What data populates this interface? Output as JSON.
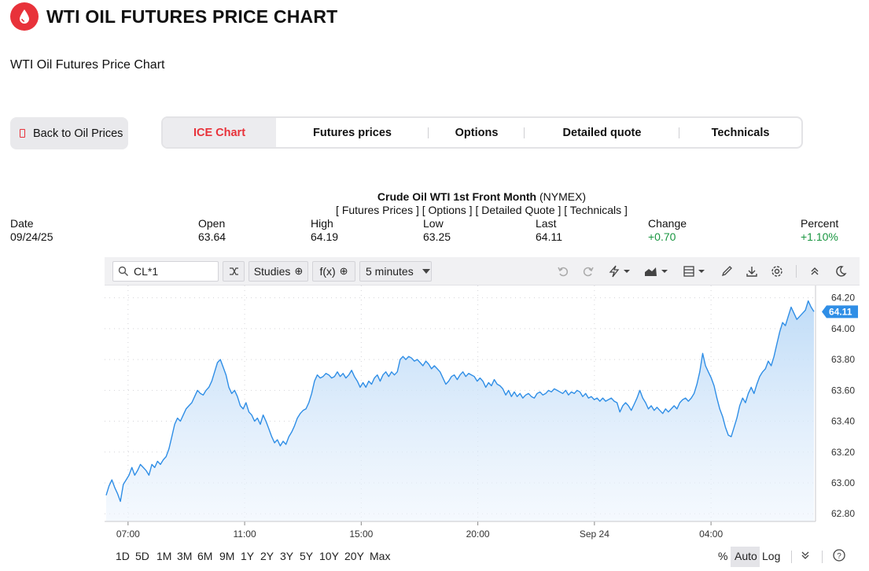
{
  "page": {
    "title": "WTI OIL FUTURES PRICE CHART",
    "subtitle": "WTI Oil Futures Price Chart",
    "back_label": "Back to Oil Prices",
    "brand_color": "#e8323a",
    "logo_icon": "oil-drop-icon"
  },
  "tabs": [
    {
      "label": "ICE Chart",
      "active": true
    },
    {
      "label": "Futures prices",
      "active": false
    },
    {
      "label": "Options",
      "active": false
    },
    {
      "label": "Detailed quote",
      "active": false
    },
    {
      "label": "Technicals",
      "active": false
    }
  ],
  "instrument": {
    "name": "Crude Oil WTI 1st Front Month",
    "exchange": "(NYMEX)",
    "links": "[ Futures Prices ] [ Options ] [ Detailed Quote ] [ Technicals ]"
  },
  "quote": {
    "date_label": "Date",
    "date": "09/24/25",
    "open_label": "Open",
    "open": "63.64",
    "high_label": "High",
    "high": "64.19",
    "low_label": "Low",
    "low": "63.25",
    "last_label": "Last",
    "last": "64.11",
    "change_label": "Change",
    "change": "+0.70",
    "percent_label": "Percent",
    "percent": "+1.10%",
    "positive_color": "#1a9641"
  },
  "toolbar": {
    "symbol": "CL*1",
    "studies_label": "Studies",
    "fx_label": "f(x)",
    "interval": "5 minutes",
    "icons": [
      "search-icon",
      "compare-icon",
      "undo-icon",
      "redo-icon",
      "lightning-icon",
      "area-chart-icon",
      "layout-icon",
      "pencil-icon",
      "download-icon",
      "settings-icon",
      "collapse-icon",
      "dark-mode-icon"
    ]
  },
  "chart_data": {
    "type": "area",
    "y_ticks": [
      "64.20",
      "64.00",
      "63.80",
      "63.60",
      "63.40",
      "63.20",
      "63.00",
      "62.80"
    ],
    "x_ticks": [
      "07:00",
      "11:00",
      "15:00",
      "20:00",
      "Sep 24",
      "04:00"
    ],
    "last_price_label": "64.11",
    "ylim": [
      62.75,
      64.28
    ],
    "grid": true,
    "line_color": "#2f8ee6",
    "x": [
      0,
      1,
      2,
      3,
      4,
      5,
      6,
      7,
      8,
      9,
      10,
      11,
      12,
      13,
      14,
      15,
      16,
      17,
      18,
      19,
      20,
      21,
      22,
      23,
      24,
      25,
      26,
      27,
      28,
      29,
      30,
      31,
      32,
      33,
      34,
      35,
      36,
      37,
      38,
      39,
      40,
      41,
      42,
      43,
      44,
      45,
      46,
      47,
      48,
      49,
      50,
      51,
      52,
      53,
      54,
      55,
      56,
      57,
      58,
      59,
      60,
      61,
      62,
      63,
      64,
      65,
      66,
      67,
      68,
      69,
      70,
      71,
      72,
      73,
      74,
      75,
      76,
      77,
      78,
      79,
      80,
      81,
      82,
      83,
      84,
      85,
      86,
      87,
      88,
      89,
      90,
      91,
      92,
      93,
      94,
      95,
      96,
      97,
      98,
      99,
      100,
      101,
      102,
      103,
      104,
      105,
      106,
      107,
      108,
      109,
      110,
      111,
      112,
      113,
      114,
      115,
      116,
      117,
      118,
      119,
      120,
      121,
      122,
      123,
      124,
      125,
      126,
      127,
      128,
      129,
      130,
      131,
      132,
      133,
      134,
      135,
      136,
      137,
      138,
      139,
      140,
      141,
      142,
      143,
      144,
      145,
      146,
      147,
      148,
      149,
      150,
      151,
      152,
      153,
      154,
      155,
      156,
      157,
      158,
      159,
      160,
      161,
      162,
      163,
      164,
      165,
      166,
      167,
      168,
      169,
      170,
      171,
      172,
      173,
      174,
      175,
      176,
      177,
      178,
      179,
      180,
      181,
      182,
      183,
      184,
      185,
      186,
      187,
      188,
      189,
      190,
      191,
      192,
      193,
      194,
      195,
      196,
      197,
      198,
      199,
      200,
      201,
      202,
      203,
      204,
      205,
      206,
      207,
      208,
      209,
      210,
      211,
      212,
      213,
      214,
      215,
      216,
      217,
      218,
      219,
      220,
      221,
      222,
      223,
      224,
      225,
      226,
      227,
      228,
      229,
      230,
      231,
      232,
      233,
      234,
      235,
      236,
      237,
      238,
      239,
      240,
      241,
      242,
      243,
      244,
      245,
      246,
      247,
      248,
      249,
      250,
      251,
      252,
      253,
      254,
      255,
      256,
      257,
      258,
      259,
      260,
      261,
      262,
      263,
      264,
      265,
      266,
      267,
      268,
      269,
      270,
      271,
      272,
      273,
      274,
      275,
      276,
      277,
      278,
      279,
      280,
      281
    ],
    "values": [
      62.92,
      62.98,
      63.02,
      62.97,
      62.93,
      62.88,
      62.99,
      63.02,
      63.05,
      63.1,
      63.05,
      63.08,
      63.12,
      63.1,
      63.08,
      63.05,
      63.12,
      63.1,
      63.14,
      63.12,
      63.15,
      63.17,
      63.22,
      63.3,
      63.38,
      63.42,
      63.4,
      63.44,
      63.48,
      63.5,
      63.52,
      63.56,
      63.6,
      63.58,
      63.57,
      63.6,
      63.62,
      63.66,
      63.72,
      63.78,
      63.8,
      63.75,
      63.7,
      63.62,
      63.58,
      63.6,
      63.56,
      63.5,
      63.48,
      63.52,
      63.46,
      63.44,
      63.4,
      63.42,
      63.38,
      63.44,
      63.4,
      63.35,
      63.3,
      63.26,
      63.28,
      63.24,
      63.27,
      63.25,
      63.3,
      63.33,
      63.37,
      63.42,
      63.45,
      63.47,
      63.48,
      63.52,
      63.58,
      63.66,
      63.7,
      63.68,
      63.69,
      63.71,
      63.7,
      63.68,
      63.69,
      63.72,
      63.69,
      63.71,
      63.68,
      63.7,
      63.73,
      63.69,
      63.66,
      63.62,
      63.65,
      63.62,
      63.66,
      63.64,
      63.68,
      63.7,
      63.66,
      63.7,
      63.72,
      63.69,
      63.72,
      63.7,
      63.72,
      63.8,
      63.82,
      63.8,
      63.82,
      63.81,
      63.79,
      63.8,
      63.78,
      63.76,
      63.79,
      63.77,
      63.74,
      63.76,
      63.74,
      63.72,
      63.68,
      63.64,
      63.66,
      63.69,
      63.7,
      63.67,
      63.7,
      63.72,
      63.69,
      63.71,
      63.7,
      63.69,
      63.66,
      63.68,
      63.66,
      63.62,
      63.65,
      63.63,
      63.67,
      63.64,
      63.63,
      63.61,
      63.57,
      63.6,
      63.56,
      63.59,
      63.56,
      63.58,
      63.55,
      63.57,
      63.58,
      63.56,
      63.55,
      63.58,
      63.59,
      63.57,
      63.58,
      63.6,
      63.59,
      63.61,
      63.6,
      63.59,
      63.58,
      63.6,
      63.57,
      63.59,
      63.58,
      63.6,
      63.59,
      63.56,
      63.58,
      63.55,
      63.56,
      63.54,
      63.55,
      63.53,
      63.55,
      63.53,
      63.54,
      63.55,
      63.53,
      63.52,
      63.46,
      63.5,
      63.52,
      63.5,
      63.47,
      63.51,
      63.55,
      63.6,
      63.55,
      63.52,
      63.48,
      63.5,
      63.47,
      63.49,
      63.47,
      63.45,
      63.48,
      63.46,
      63.48,
      63.5,
      63.48,
      63.52,
      63.54,
      63.55,
      63.53,
      63.55,
      63.58,
      63.64,
      63.72,
      63.84,
      63.76,
      63.72,
      63.68,
      63.63,
      63.55,
      63.48,
      63.43,
      63.36,
      63.31,
      63.3,
      63.36,
      63.42,
      63.5,
      63.55,
      63.52,
      63.58,
      63.62,
      63.58,
      63.64,
      63.69,
      63.72,
      63.74,
      63.79,
      63.76,
      63.82,
      63.9,
      63.98,
      64.04,
      64.02,
      64.08,
      64.14,
      64.1,
      64.06,
      64.08,
      64.1,
      64.12,
      64.18,
      64.14,
      64.11
    ]
  },
  "range_bar": {
    "ranges": [
      "1D",
      "5D",
      "1M",
      "3M",
      "6M",
      "9M",
      "1Y",
      "2Y",
      "3Y",
      "5Y",
      "10Y",
      "20Y",
      "Max"
    ],
    "percent_label": "%",
    "auto_label": "Auto",
    "log_label": "Log"
  }
}
